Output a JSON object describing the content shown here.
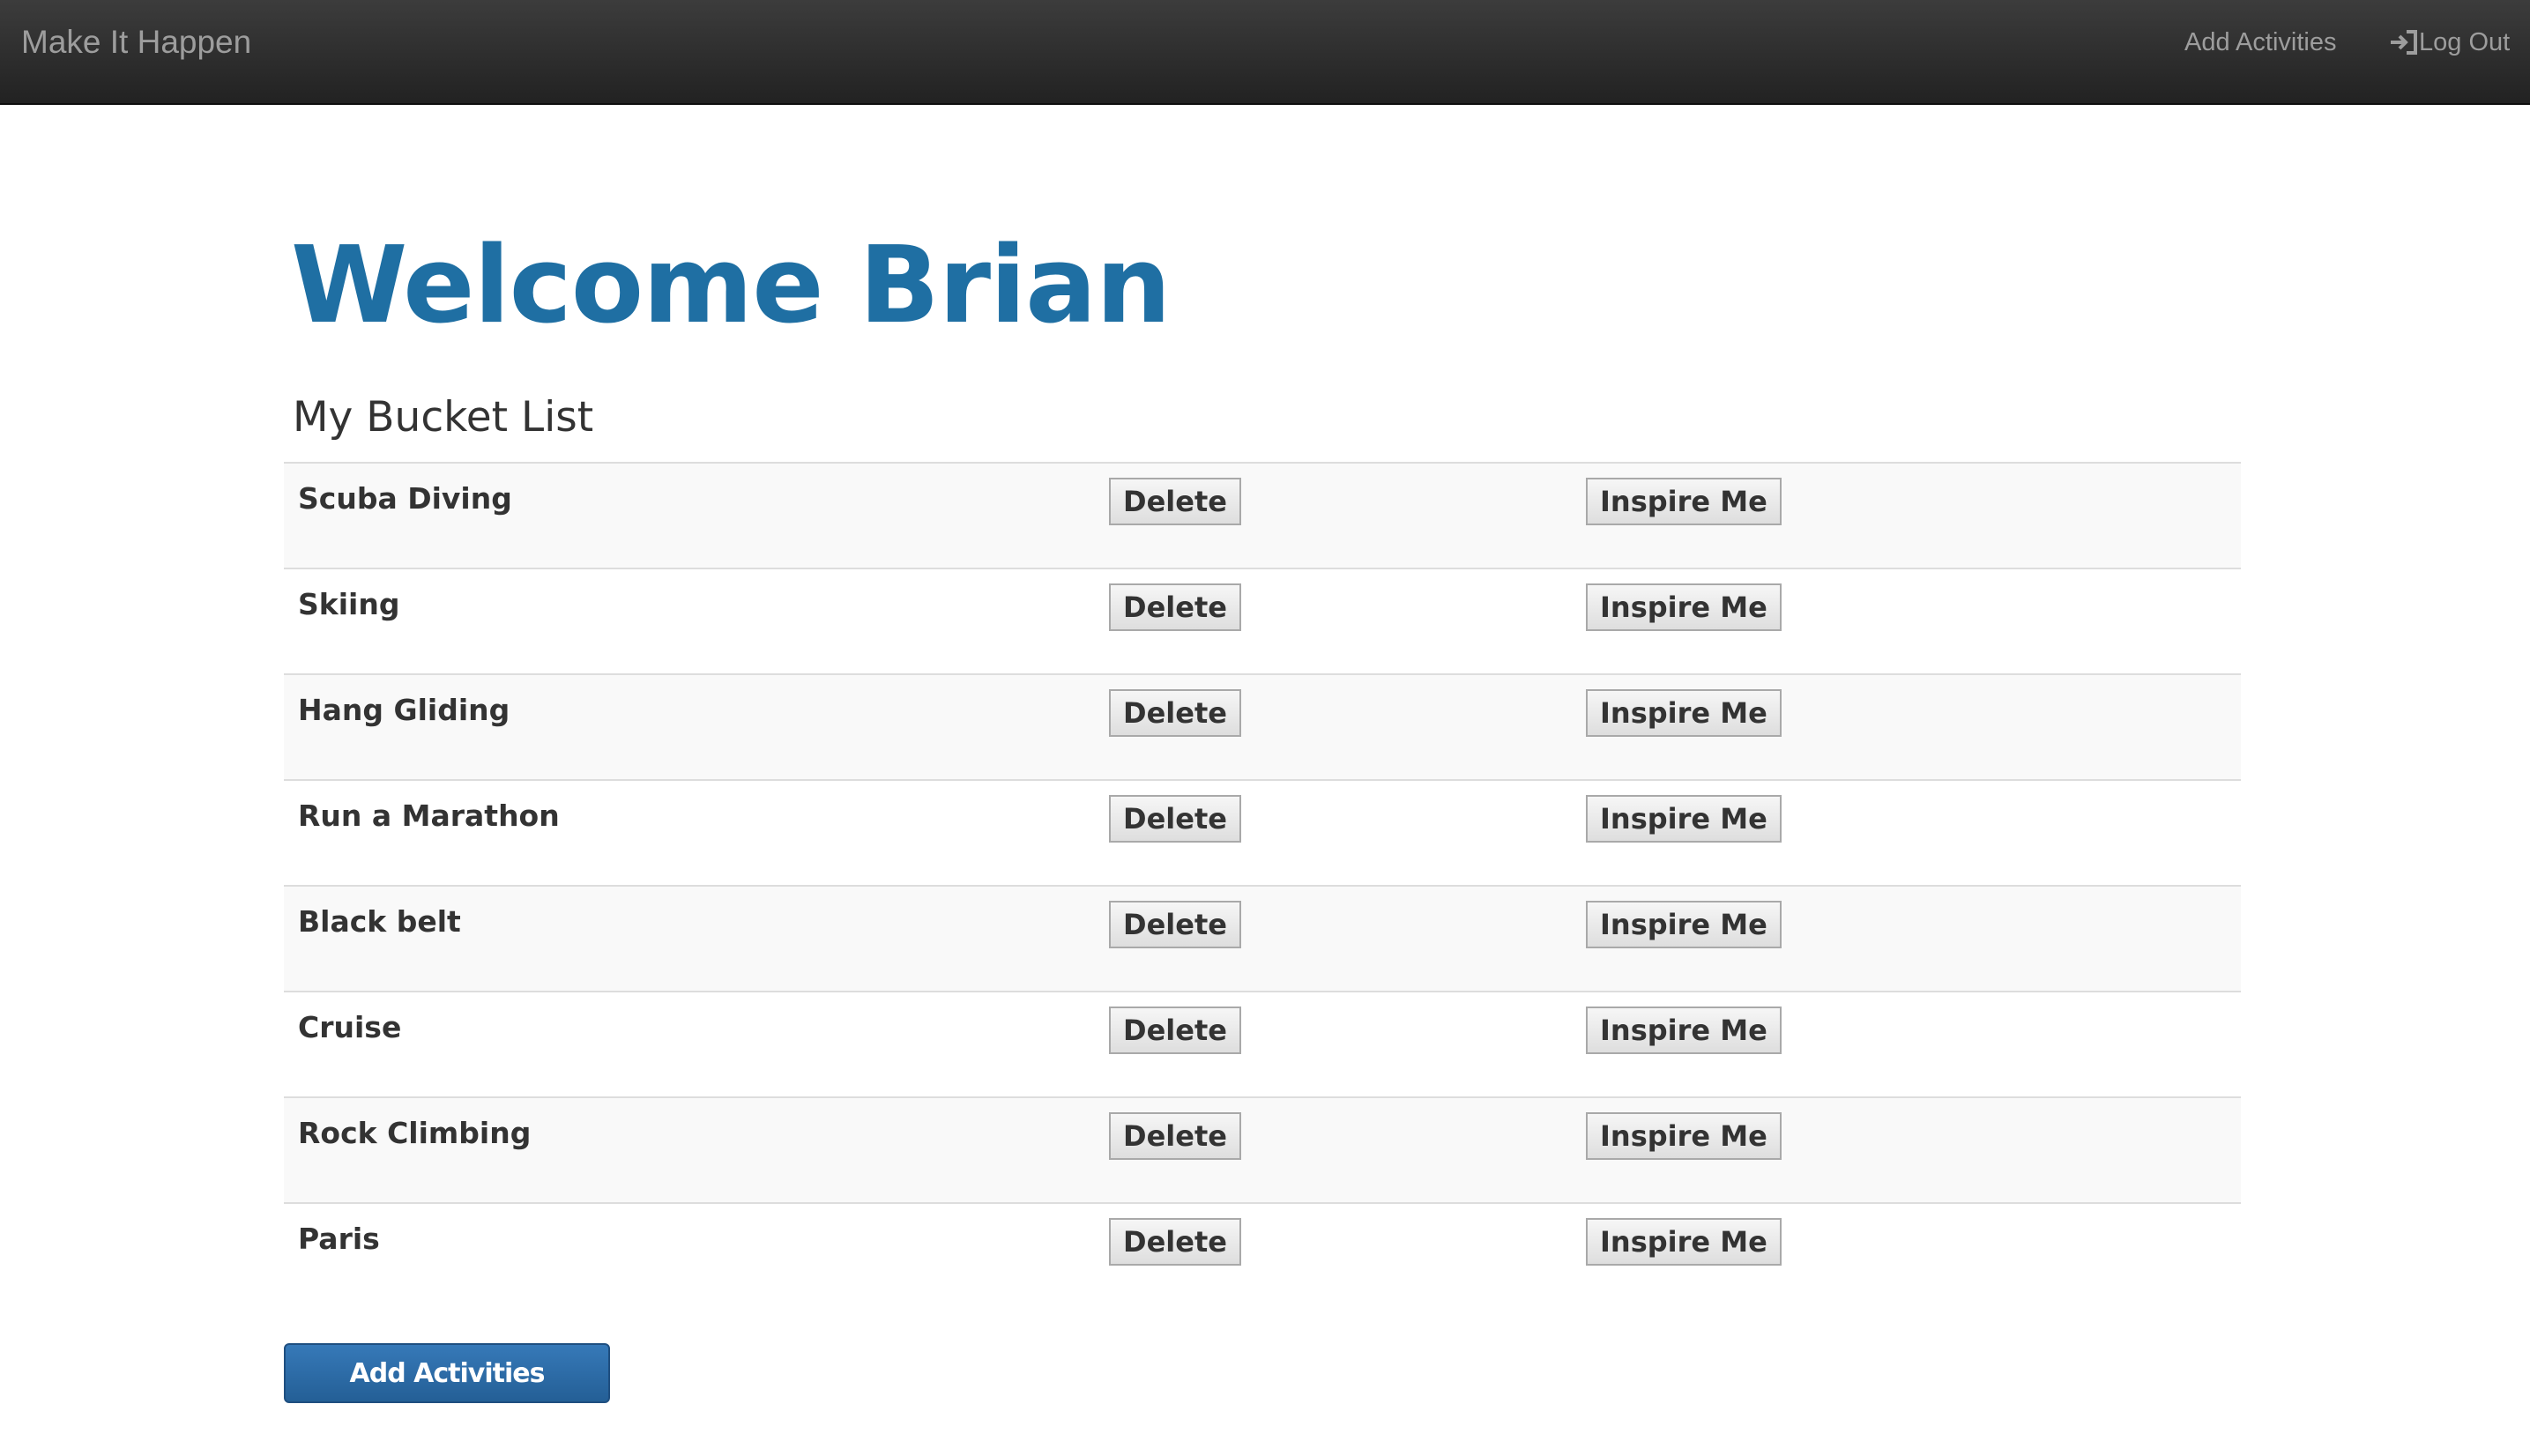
{
  "navbar": {
    "brand": "Make It Happen",
    "add_activities": "Add Activities",
    "log_out": "Log Out",
    "log_out_icon": "log-in-arrow-icon"
  },
  "main": {
    "title": "Welcome Brian",
    "subtitle": "My Bucket List",
    "items": [
      {
        "name": "Scuba Diving"
      },
      {
        "name": "Skiing"
      },
      {
        "name": "Hang Gliding"
      },
      {
        "name": "Run a Marathon"
      },
      {
        "name": "Black belt"
      },
      {
        "name": "Cruise"
      },
      {
        "name": "Rock Climbing"
      },
      {
        "name": "Paris"
      }
    ],
    "delete_label": "Delete",
    "inspire_label": "Inspire Me",
    "add_button": "Add Activities"
  },
  "colors": {
    "title": "#1f6fa3",
    "primary_button": "#2a6aa6",
    "navbar": "#2b2b2b"
  }
}
